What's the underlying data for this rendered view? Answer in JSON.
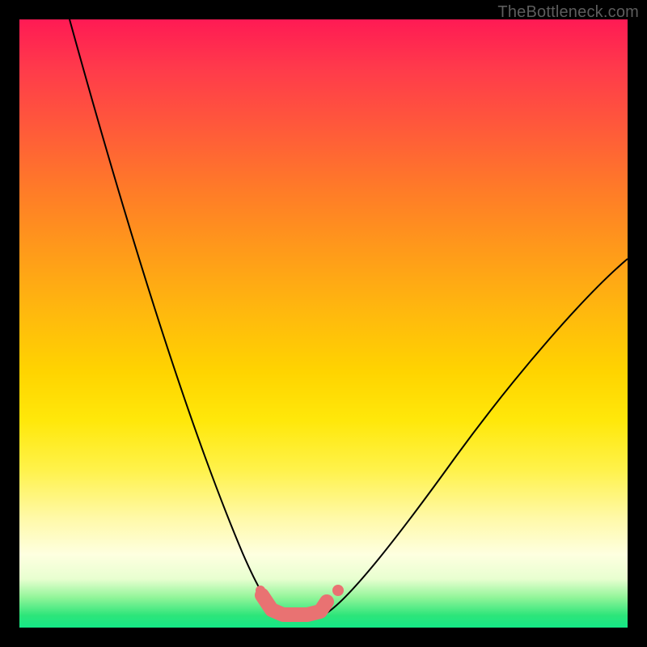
{
  "watermark": "TheBottleneck.com",
  "colors": {
    "frame": "#000000",
    "curve": "#000000",
    "worm": "#e97272",
    "gradient_stops": [
      "#ff1a54",
      "#ff9a1a",
      "#ffe80a",
      "#feffe0",
      "#14e786"
    ]
  },
  "chart_data": {
    "type": "line",
    "title": "",
    "xlabel": "",
    "ylabel": "",
    "xlim": [
      0,
      100
    ],
    "ylim": [
      0,
      100
    ],
    "grid": false,
    "legend": false,
    "series": [
      {
        "name": "left-branch",
        "x": [
          8,
          12,
          16,
          20,
          24,
          28,
          32,
          36,
          38,
          40,
          42
        ],
        "y": [
          100,
          86,
          72,
          58,
          44,
          31,
          19,
          9,
          5,
          2,
          1
        ]
      },
      {
        "name": "right-branch",
        "x": [
          50,
          54,
          58,
          64,
          72,
          80,
          88,
          96,
          100
        ],
        "y": [
          1,
          3,
          6,
          12,
          22,
          33,
          44,
          55,
          61
        ]
      },
      {
        "name": "valley-worm",
        "x": [
          40,
          42,
          44,
          47,
          50
        ],
        "y": [
          2,
          1,
          1,
          1,
          2
        ]
      }
    ],
    "annotations": [
      {
        "type": "dot",
        "x": 40,
        "y": 2
      },
      {
        "type": "dot",
        "x": 52,
        "y": 4
      }
    ]
  }
}
